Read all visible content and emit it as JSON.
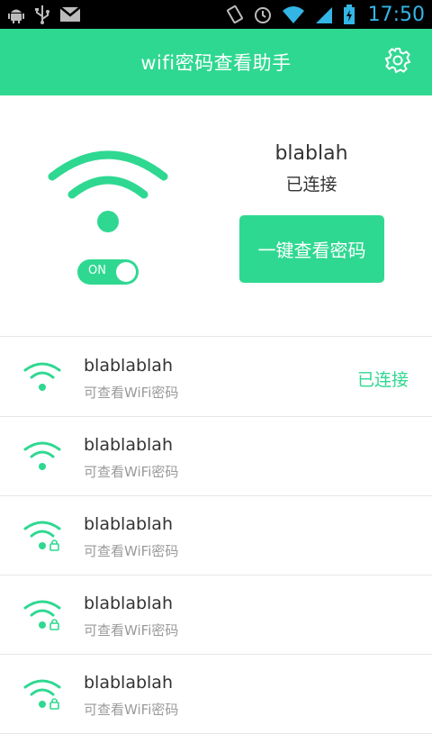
{
  "colors": {
    "accent": "#2fd891",
    "status_bar": "#000000",
    "time": "#33b5e5"
  },
  "status_bar": {
    "icons_left": [
      "android-debug-icon",
      "usb-icon",
      "gmail-icon"
    ],
    "icons_right": [
      "rotate-icon",
      "alarm-icon",
      "wifi-signal-icon",
      "cell-signal-icon",
      "battery-charging-icon"
    ],
    "time": "17:50"
  },
  "header": {
    "title": "wifi密码查看助手",
    "settings_icon": "gear-icon"
  },
  "current": {
    "ssid": "blablah",
    "status": "已连接",
    "toggle_label": "ON",
    "toggle_on": true,
    "view_button": "一键查看密码"
  },
  "networks": [
    {
      "ssid": "blablablah",
      "subtitle": "可查看WiFi密码",
      "status": "已连接",
      "locked": false
    },
    {
      "ssid": "blablablah",
      "subtitle": "可查看WiFi密码",
      "status": "",
      "locked": false
    },
    {
      "ssid": "blablablah",
      "subtitle": "可查看WiFi密码",
      "status": "",
      "locked": true
    },
    {
      "ssid": "blablablah",
      "subtitle": "可查看WiFi密码",
      "status": "",
      "locked": true
    },
    {
      "ssid": "blablablah",
      "subtitle": "可查看WiFi密码",
      "status": "",
      "locked": true
    }
  ]
}
